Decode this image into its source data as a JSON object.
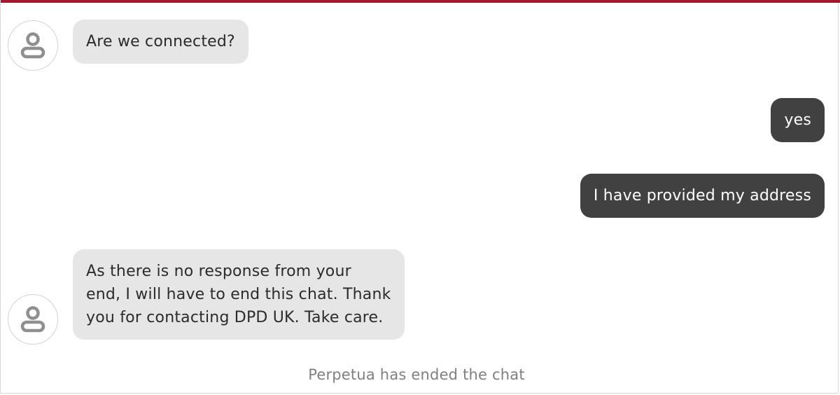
{
  "theme": {
    "accent_color": "#a3182f",
    "agent_bubble_color": "#e6e6e6",
    "user_bubble_color": "#414141",
    "avatar_icon_color": "#8f8f8f",
    "system_text_color": "#7f7f7f"
  },
  "messages": [
    {
      "sender": "agent",
      "avatar_icon": "user-icon",
      "lines": [
        "Are we connected?"
      ]
    },
    {
      "sender": "user",
      "lines": [
        "yes"
      ]
    },
    {
      "sender": "user",
      "lines": [
        "I have provided my address"
      ]
    },
    {
      "sender": "agent",
      "avatar_icon": "user-icon",
      "lines": [
        "As there is no response from your",
        "end, I will have to end this chat. Thank",
        "you for contacting DPD UK. Take care."
      ]
    }
  ],
  "system_message": "Perpetua has ended the chat"
}
